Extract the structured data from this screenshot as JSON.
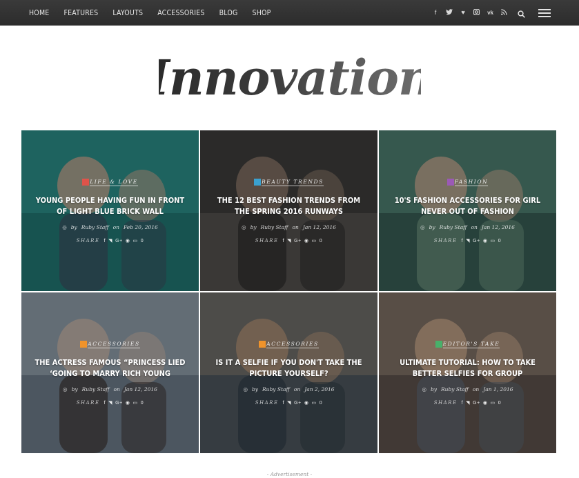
{
  "nav": {
    "items": [
      "HOME",
      "FEATURES",
      "LAYOUTS",
      "ACCESSORIES",
      "BLOG",
      "SHOP"
    ],
    "social_icons": [
      "facebook-icon",
      "twitter-icon",
      "heart-icon",
      "instagram-icon",
      "vk-icon",
      "rss-icon"
    ],
    "social_glyphs": [
      "f",
      "•",
      "♥",
      "▣",
      "vk",
      "∴"
    ]
  },
  "logo": {
    "text": "Innovation"
  },
  "posts": [
    {
      "category": "LIFE & LOVE",
      "category_color": "#e0534a",
      "title": "YOUNG PEOPLE HAVING FUN IN FRONT OF LIGHT BLUE BRICK WALL",
      "author": "Ruby Staff",
      "date": "Feb 20, 2016",
      "share_label": "SHARE",
      "comments": "0",
      "palette": [
        "#2a8a84",
        "#1d6a66",
        "#c9a08b",
        "#3b4a5c"
      ]
    },
    {
      "category": "BEAUTY TRENDS",
      "category_color": "#3aa1d0",
      "title": "THE 12 BEST FASHION TRENDS FROM THE SPRING 2016 RUNWAYS",
      "author": "Ruby Staff",
      "date": "Jan 12, 2016",
      "share_label": "SHARE",
      "comments": "0",
      "palette": [
        "#3c3b3a",
        "#5a5753",
        "#8d7a6a",
        "#2a2a2a"
      ]
    },
    {
      "category": "FASHION",
      "category_color": "#9b59b6",
      "title": "10'S FASHION ACCESSORIES FOR GIRL NEVER OUT OF FASHION",
      "author": "Ruby Staff",
      "date": "Jan 12, 2016",
      "share_label": "SHARE",
      "comments": "0",
      "palette": [
        "#4c7a6c",
        "#2f4f47",
        "#c7a58e",
        "#6a8f7b"
      ]
    },
    {
      "category": "ACCESSORIES",
      "category_color": "#f0932b",
      "title": "THE ACTRESS FAMOUS “PRINCESS LIED ‘GOING TO MARRY RICH YOUNG",
      "author": "Ruby Staff",
      "date": "Jan 12, 2016",
      "share_label": "SHARE",
      "comments": "0",
      "palette": [
        "#8a97a3",
        "#5d6b77",
        "#c7b2a3",
        "#3a3230"
      ]
    },
    {
      "category": "ACCESSORIES",
      "category_color": "#f0932b",
      "title": "IS IT A SELFIE IF YOU DON'T TAKE THE PICTURE YOURSELF?",
      "author": "Ruby Staff",
      "date": "Jan 2, 2016",
      "share_label": "SHARE",
      "comments": "0",
      "palette": [
        "#6b6a66",
        "#3e4b55",
        "#b08f74",
        "#2d3a44"
      ]
    },
    {
      "category": "EDITOR'S TAKE",
      "category_color": "#48b06a",
      "title": "ULTIMATE TUTORIAL: HOW TO TAKE BETTER SELFIES FOR GROUP",
      "author": "Ruby Staff",
      "date": "Jan 1, 2016",
      "share_label": "SHARE",
      "comments": "0",
      "palette": [
        "#7a6d62",
        "#4d4540",
        "#c9a58a",
        "#5a6470"
      ]
    }
  ],
  "advertisement": "- Advertisement -"
}
